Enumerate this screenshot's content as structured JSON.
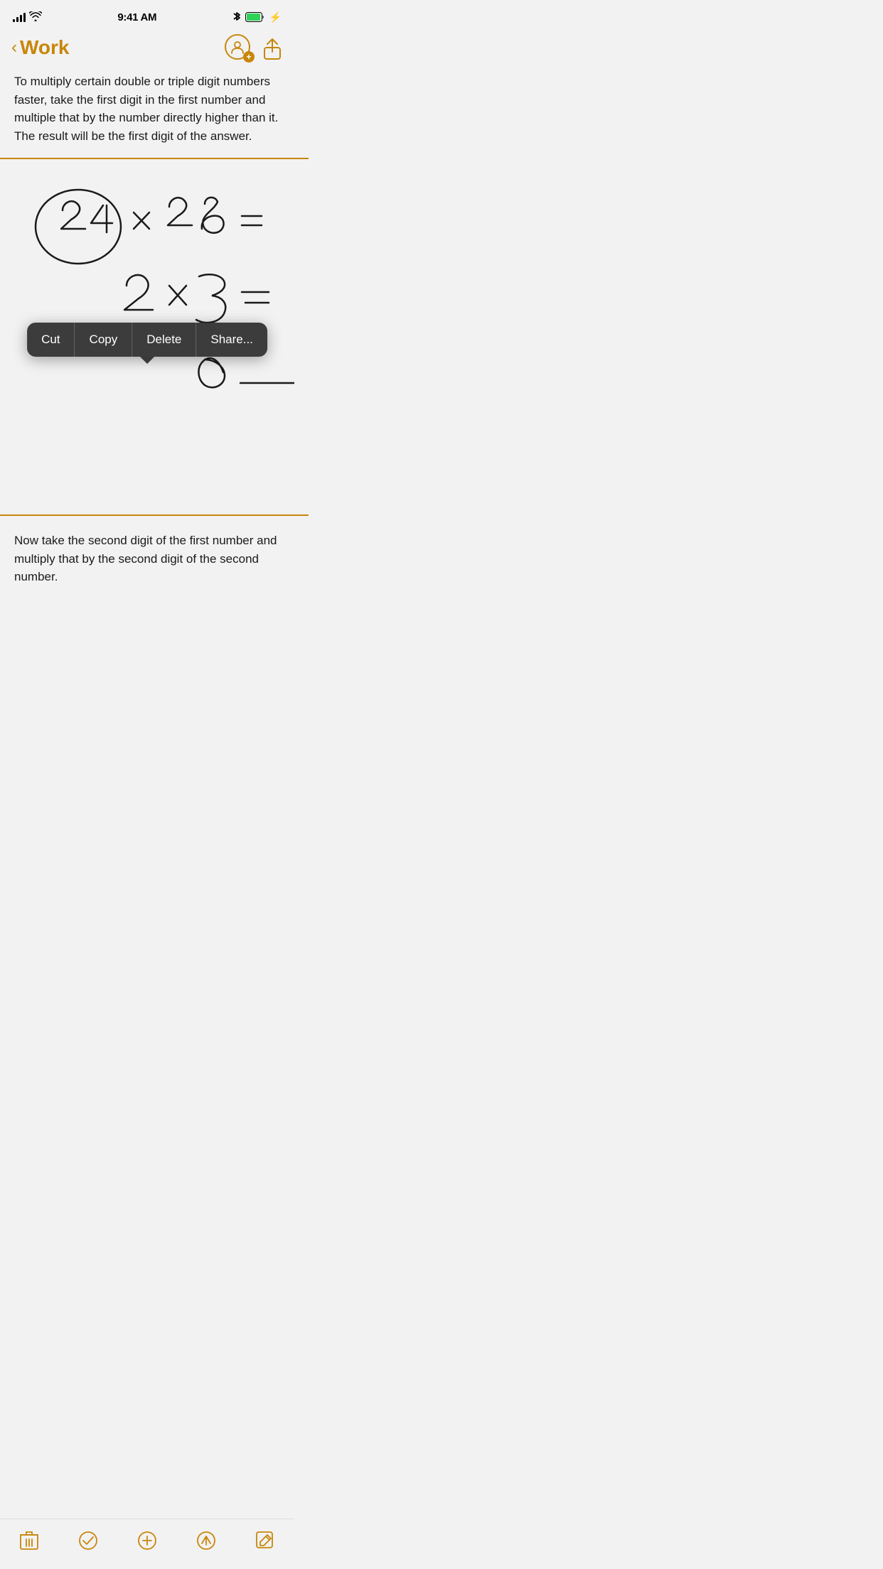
{
  "status": {
    "time": "9:41 AM",
    "signal": "full",
    "wifi": true,
    "bluetooth": true,
    "battery": "full",
    "charging": true
  },
  "nav": {
    "back_label": "Work",
    "back_icon": "‹",
    "title": "Work"
  },
  "note": {
    "text1": "To multiply certain double or triple digit numbers faster, take the first digit in the first number and multiple that by the number directly higher than it. The result will be the first digit of the answer.",
    "text2": "Now take the second digit of the first number and multiply that by the second digit of the second number."
  },
  "context_menu": {
    "items": [
      "Cut",
      "Copy",
      "Delete",
      "Share..."
    ]
  },
  "toolbar": {
    "items": [
      "trash",
      "checkmark-circle",
      "plus-circle",
      "location-arrow",
      "compose"
    ]
  }
}
